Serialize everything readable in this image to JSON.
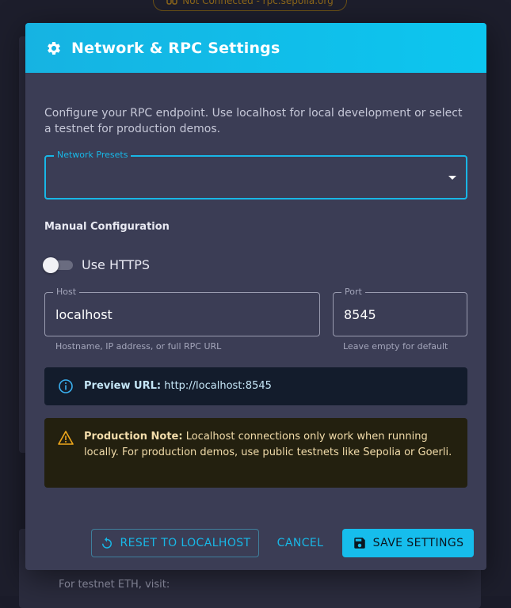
{
  "background": {
    "status_text": "Not Connected - rpc.sepolia.org",
    "faucet_text": "For testnet ETH, visit:"
  },
  "modal": {
    "title": "Network & RPC Settings",
    "intro": "Configure your RPC endpoint. Use localhost for local development or select a testnet for production demos.",
    "presets": {
      "label": "Network Presets",
      "value": ""
    },
    "manual_section_title": "Manual Configuration",
    "https_toggle": {
      "label": "Use HTTPS",
      "checked": false
    },
    "host": {
      "label": "Host",
      "value": "localhost",
      "helper": "Hostname, IP address, or full RPC URL"
    },
    "port": {
      "label": "Port",
      "value": "8545",
      "helper": "Leave empty for default"
    },
    "preview": {
      "label": "Preview URL:",
      "value": "http://localhost:8545"
    },
    "production_note": {
      "label": "Production Note:",
      "text": "Localhost connections only work when running locally. For production demos, use public testnets like Sepolia or Goerli."
    },
    "actions": {
      "reset_label": "RESET TO LOCALHOST",
      "cancel_label": "CANCEL",
      "save_label": "SAVE SETTINGS"
    }
  },
  "colors": {
    "accent": "#18b7e6",
    "modal_bg": "#3b3d55",
    "info_bg": "#131c2c",
    "warning_bg": "#23200f",
    "warning_icon": "#f0a81c",
    "info_icon": "#3ab0f0"
  },
  "icons": {
    "header": "gear-icon",
    "info": "info-icon",
    "warning": "warning-icon",
    "reset": "refresh-icon",
    "save": "save-icon"
  }
}
